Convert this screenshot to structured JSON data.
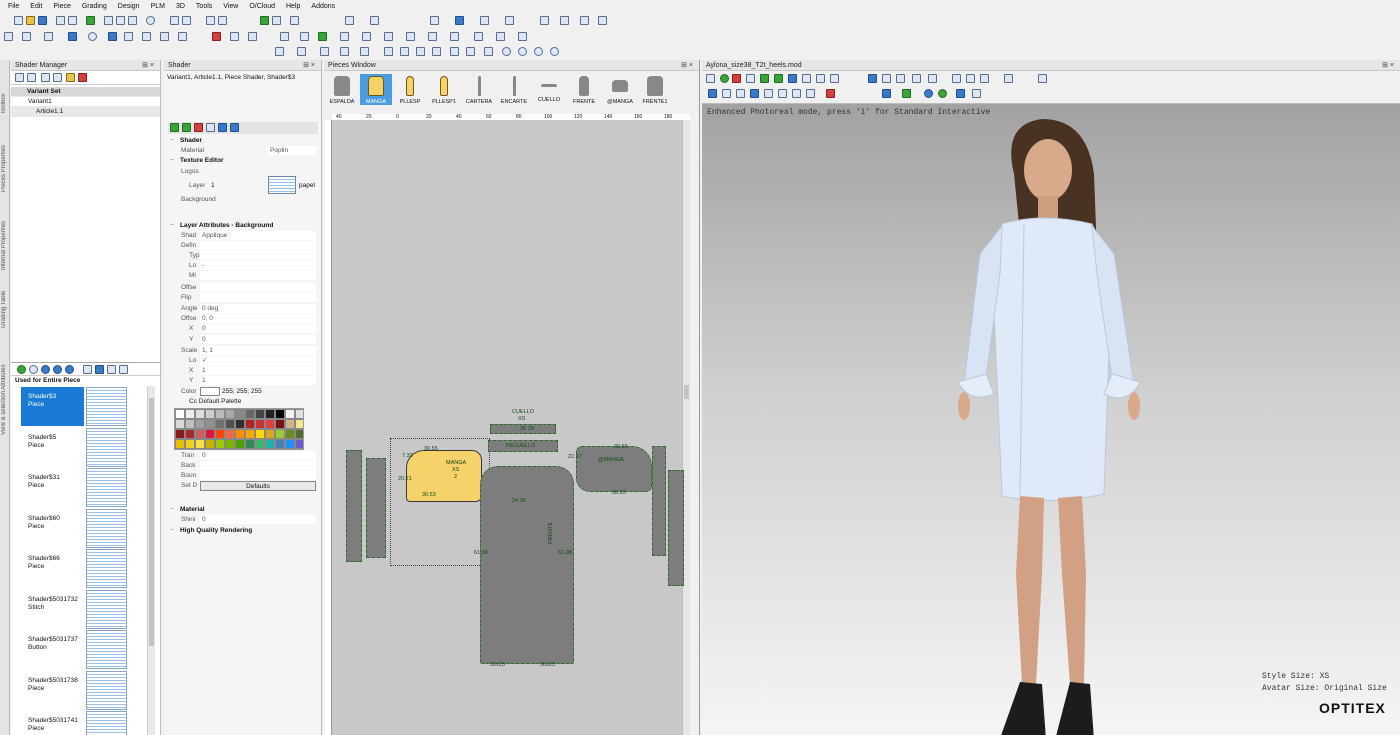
{
  "menu": [
    "File",
    "Edit",
    "Piece",
    "Grading",
    "Design",
    "PLM",
    "3D",
    "Tools",
    "View",
    "O/Cloud",
    "Help",
    "Addons"
  ],
  "shader_manager": {
    "title": "Shader Manager",
    "tree": {
      "header": "Variant Set",
      "variant": "Variant1",
      "article": "Article1.1"
    },
    "used_header": "Used for Entire Piece",
    "items": [
      {
        "name": "Shader$3",
        "type": "Piece"
      },
      {
        "name": "Shader$5",
        "type": "Piece"
      },
      {
        "name": "Shader$31",
        "type": "Piece"
      },
      {
        "name": "Shader$60",
        "type": "Piece"
      },
      {
        "name": "Shader$66",
        "type": "Piece"
      },
      {
        "name": "Shader$5031732",
        "type": "Stitch"
      },
      {
        "name": "Shader$5031737",
        "type": "Button"
      },
      {
        "name": "Shader$5031738",
        "type": "Piece"
      },
      {
        "name": "Shader$5031741",
        "type": "Piece"
      }
    ]
  },
  "shader": {
    "title": "Shader",
    "path": "Variant1, Article1.1, Piece Shader, Shader$3",
    "sections": {
      "shader": "Shader",
      "texture_editor": "Texture Editor",
      "layer_attributes": "Layer Attributes - Background",
      "material": "Material",
      "hq": "High Quality Rendering"
    },
    "rows": {
      "material_k": "Material",
      "material_v": "Poplin",
      "logos": "Logos",
      "layer_k": "Layer",
      "layer_v": "1",
      "layer_tex": "papel",
      "background": "Background",
      "shad_k": "Shad",
      "shad_v": "Applique",
      "defin": "Defin",
      "typ": "Typ",
      "lo": "Lo",
      "lo_v": "-",
      "mi": "Mi",
      "offse": "Offse",
      "flip": "Flip",
      "angle_k": "Angle",
      "angle_v": "0 deg",
      "offs2_k": "Offse",
      "offs2_v": "0, 0",
      "x_k": "X",
      "x_v": "0",
      "y_k": "Y",
      "y_v": "0",
      "scale_k": "Scale",
      "scale_v": "1, 1",
      "lo2": "Lo",
      "lo2_v": "✓",
      "sx_k": "X",
      "sx_v": "1",
      "sy_k": "Y",
      "sy_v": "1",
      "color_k": "Color",
      "color_v": "255; 255; 255",
      "palette": "Cc Default Palette",
      "trans_k": "Tran",
      "trans_v": "0",
      "back": "Back",
      "boun": "Boun",
      "setd": "Set D",
      "defaults": "Defaults",
      "shini_k": "Shini",
      "shini_v": "0"
    },
    "palette_colors": [
      "#ffffff",
      "#eeeeee",
      "#dddddd",
      "#cccccc",
      "#bbbbbb",
      "#aaaaaa",
      "#888888",
      "#666666",
      "#444444",
      "#222222",
      "#000000",
      "#f2f2f2",
      "#e0e0e0",
      "#d8d8d8",
      "#c0c0c0",
      "#a0a0a0",
      "#909090",
      "#707070",
      "#505050",
      "#303030",
      "#b22222",
      "#c83232",
      "#e04040",
      "#7a1414",
      "#d2b48c",
      "#f0e68c",
      "#8b1a1a",
      "#a52a2a",
      "#cd5c5c",
      "#dc143c",
      "#ff4500",
      "#ff6347",
      "#ff8c00",
      "#ffa500",
      "#ffd700",
      "#daa520",
      "#9acd32",
      "#6b8e23",
      "#556b2f",
      "#e8c000",
      "#f0d020",
      "#f8e040",
      "#c8b400",
      "#a0c800",
      "#78b400",
      "#50a000",
      "#2e8b57",
      "#3cb371",
      "#20b2aa",
      "#4682b4",
      "#1e90ff",
      "#6a5acd"
    ]
  },
  "pieces_window": {
    "title": "Pieces Window",
    "pieces": [
      "ESPALDA",
      "MANGA",
      "PLLESP",
      "PLLESP1",
      "CARTERA",
      "ENCARTE",
      "CUELLO",
      "FRENTE",
      "@MANGA",
      "FRENTE1"
    ],
    "ruler": [
      "40",
      "20",
      "0",
      "20",
      "40",
      "60",
      "80",
      "100",
      "120",
      "140",
      "160",
      "180"
    ],
    "labels": {
      "cuello": "CUELLO",
      "xs1": "XS",
      "pecuello": "PECUELLO",
      "manga": "MANGA",
      "xs2": "XS",
      "two": "2",
      "manga2": "@MANGA",
      "frente": "FRENTE",
      "m1": "30.55",
      "m2": "20.21",
      "m3": "30.53",
      "m4": "61.08",
      "m5": "61.08",
      "m6": "24.06",
      "m7": "30x23",
      "m8": "30x23",
      "m9": "30.65",
      "m10": "30.53",
      "m11": "22.17",
      "m12": "7.32",
      "m13": "36.19"
    }
  },
  "view3d": {
    "title": "Aylona_size38_T2t_heels.mod",
    "status": "Enhanced Photoreal mode, press 'i' for Standard Interactive",
    "style_size": "Style Size: XS",
    "avatar_size": "Avatar Size: Original Size",
    "brand": "OPTITEX"
  },
  "left_tabs": [
    "Toolbox",
    "Pieces Properties",
    "Internal Properties",
    "Grading Table",
    "View & selection Attributes"
  ]
}
